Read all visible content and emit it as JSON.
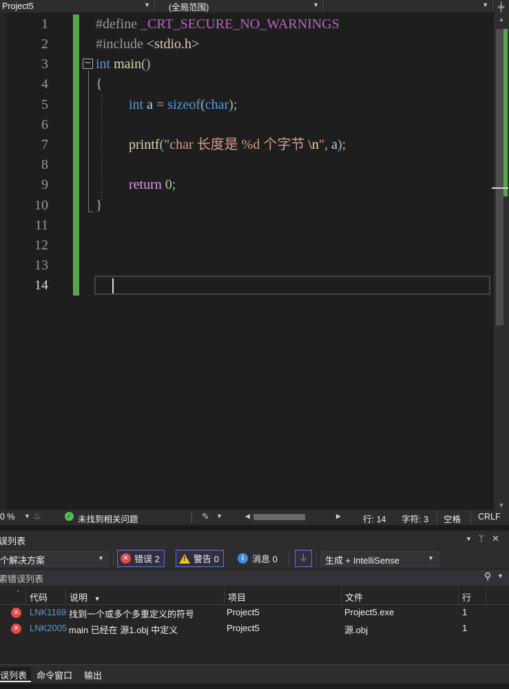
{
  "navbar": {
    "project": "Project5",
    "scope": "(全局范围)",
    "member": ""
  },
  "editor": {
    "line_numbers": [
      "1",
      "2",
      "3",
      "4",
      "5",
      "6",
      "7",
      "8",
      "9",
      "10",
      "11",
      "12",
      "13",
      "14"
    ],
    "current_line": 14,
    "lines": {
      "l1_directive": "#define",
      "l1_macro": "_CRT_SECURE_NO_WARNINGS",
      "l2_directive": "#include",
      "l2_header": "<stdio.h>",
      "l3_type": "int",
      "l3_name": "main",
      "l3_parens": "()",
      "l4_brace": "{",
      "l5_type": "int",
      "l5_var": "a",
      "l5_eq": "=",
      "l5_op": "sizeof",
      "l5_paren_open": "(",
      "l5_arg": "char",
      "l5_end": ");",
      "l7_fn": "printf",
      "l7_paren_open": "(",
      "l7_string_a": "\"char 长度是 %d 个字节 ",
      "l7_escape": "\\n",
      "l7_string_b": "\"",
      "l7_comma": ",",
      "l7_var": "a",
      "l7_end": ");",
      "l9_kw": "return",
      "l9_num": "0",
      "l9_end": ";",
      "l10_brace": "}"
    },
    "change_bar_color": "#57a64a"
  },
  "status": {
    "zoom": "0 %",
    "no_issues": "未找到相关问题",
    "line": "行: 14",
    "col": "字符: 3",
    "indent": "空格",
    "eol": "CRLF"
  },
  "error_list": {
    "title": "误列表",
    "scope_combo": "个解决方案",
    "errors_label": "错误 2",
    "warnings_label": "警告 0",
    "messages_label": "消息 0",
    "build_filter": "生成 + IntelliSense",
    "search_placeholder": "索错误列表",
    "columns": {
      "code": "代码",
      "description": "说明",
      "project": "项目",
      "file": "文件",
      "line": "行"
    },
    "rows": [
      {
        "code": "LNK1169",
        "description": "找到一个或多个多重定义的符号",
        "project": "Project5",
        "file": "Project5.exe",
        "line": "1"
      },
      {
        "code": "LNK2005",
        "description": "main 已经在 源1.obj 中定义",
        "project": "Project5",
        "file": "源.obj",
        "line": "1"
      }
    ]
  },
  "bottom_tabs": [
    "误列表",
    "命令窗口",
    "输出"
  ],
  "icons": {
    "error": "error-circle-icon",
    "warning": "warning-triangle-icon",
    "info": "info-circle-icon",
    "ok": "check-circle-icon",
    "filter": "funnel-icon",
    "search": "search-icon"
  },
  "colors": {
    "error": "#e5484d",
    "warning": "#f0c518",
    "info": "#3d8ee5",
    "keyword": "#569cd6",
    "string": "#d69d85"
  }
}
